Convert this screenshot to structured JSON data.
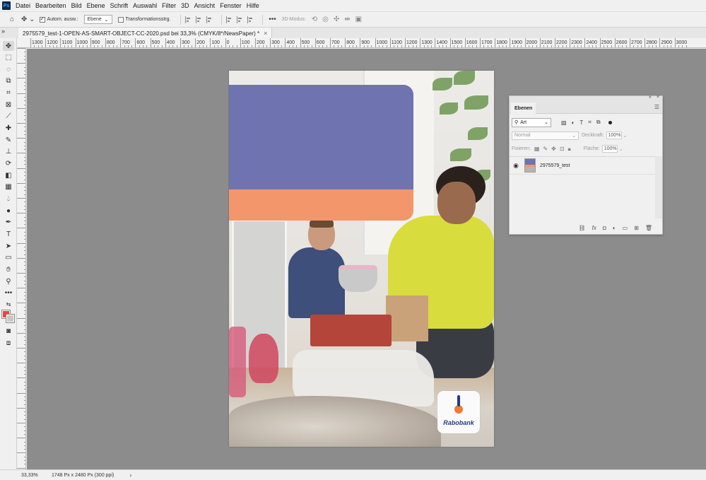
{
  "menu": {
    "logo": "Ps",
    "items": [
      "Datei",
      "Bearbeiten",
      "Bild",
      "Ebene",
      "Schrift",
      "Auswahl",
      "Filter",
      "3D",
      "Ansicht",
      "Fenster",
      "Hilfe"
    ]
  },
  "options": {
    "auto_select_label": "Autom. ausw.:",
    "auto_select_target": "Ebene",
    "transform_label": "Transformationsstrg.",
    "more": "•••",
    "mode_label": "3D-Modus:"
  },
  "tab": {
    "title": "2975579_test-1-OPEN-AS-SMART-OBJECT-CC-2020.psd bei 33,3% (CMYK/8*/NewsPaper) *",
    "close": "×"
  },
  "ruler": {
    "top_labels": [
      "1300",
      "1200",
      "1100",
      "1000",
      "900",
      "800",
      "700",
      "600",
      "500",
      "400",
      "300",
      "200",
      "100",
      "0",
      "100",
      "200",
      "300",
      "400",
      "500",
      "600",
      "700",
      "800",
      "900",
      "1000",
      "1100",
      "1200",
      "1300",
      "1400",
      "1500",
      "1600",
      "1700",
      "1800",
      "1900",
      "2000",
      "2100",
      "2200",
      "2300",
      "2400",
      "2500",
      "2600",
      "2700",
      "2800",
      "2900",
      "3000"
    ]
  },
  "document": {
    "brand": "Rabobank"
  },
  "colors": {
    "foreground": "#e8453c",
    "background": "#c8c8c8",
    "block_blue": "#6f74b0",
    "block_orange": "#f3966c"
  },
  "layers_panel": {
    "tab": "Ebenen",
    "filter": "Art",
    "blend_mode": "Normal",
    "opacity_label": "Deckkraft:",
    "opacity_value": "100%",
    "lock_label": "Fixieren:",
    "fill_label": "Fläche:",
    "fill_value": "100%",
    "layers": [
      {
        "name": "2975579_test",
        "visible": true
      }
    ]
  },
  "status": {
    "zoom": "33,33%",
    "doc_size": "1748 Px x 2480 Px (300 ppi)",
    "arrow": "›"
  }
}
